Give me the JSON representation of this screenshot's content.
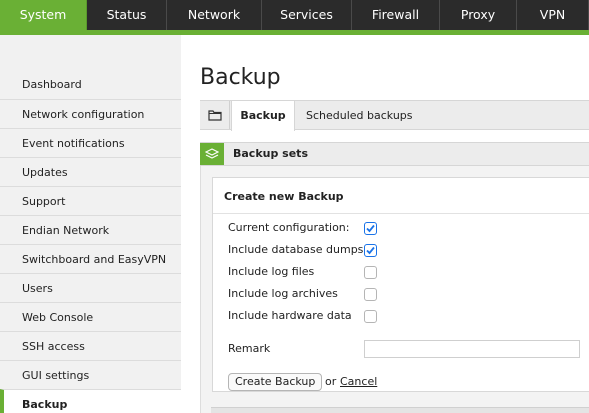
{
  "topnav": {
    "tabs": [
      {
        "label": "System",
        "active": true
      },
      {
        "label": "Status",
        "active": false
      },
      {
        "label": "Network",
        "active": false
      },
      {
        "label": "Services",
        "active": false
      },
      {
        "label": "Firewall",
        "active": false
      },
      {
        "label": "Proxy",
        "active": false
      },
      {
        "label": "VPN",
        "active": false
      }
    ]
  },
  "sidebar": {
    "items": [
      {
        "label": "Dashboard"
      },
      {
        "label": "Network configuration"
      },
      {
        "label": "Event notifications"
      },
      {
        "label": "Updates"
      },
      {
        "label": "Support"
      },
      {
        "label": "Endian Network"
      },
      {
        "label": "Switchboard and EasyVPN"
      },
      {
        "label": "Users"
      },
      {
        "label": "Web Console"
      },
      {
        "label": "SSH access"
      },
      {
        "label": "GUI settings"
      },
      {
        "label": "Backup",
        "active": true
      }
    ]
  },
  "main": {
    "title": "Backup",
    "tabs": [
      {
        "label": "Backup",
        "active": true
      },
      {
        "label": "Scheduled backups",
        "active": false
      }
    ],
    "section_label": "Backup sets",
    "form": {
      "heading": "Create new Backup",
      "options": [
        {
          "label": "Current configuration:",
          "checked": true
        },
        {
          "label": "Include database dumps",
          "checked": true
        },
        {
          "label": "Include log files",
          "checked": false
        },
        {
          "label": "Include log archives",
          "checked": false
        },
        {
          "label": "Include hardware data",
          "checked": false
        }
      ],
      "remark_label": "Remark",
      "remark_value": "",
      "create_button": "Create Backup",
      "or_text": "or",
      "cancel_link": "Cancel"
    }
  },
  "colors": {
    "accent": "#6ab035",
    "nav_bg": "#2b2b2b",
    "checkbox_checked": "#1a73e8"
  },
  "icons": {
    "folder": "folder-icon",
    "section": "layers-icon",
    "checkmark": "checkmark-icon"
  }
}
